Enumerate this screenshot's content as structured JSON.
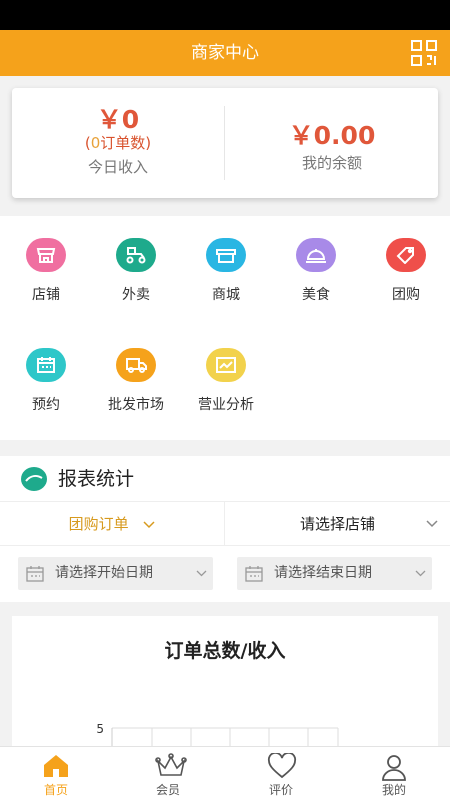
{
  "header": {
    "title": "商家中心",
    "qr_icon": "qr-code-icon"
  },
  "summary": {
    "income_value": "￥0",
    "orders_open": "(",
    "orders_count": "0",
    "orders_label": "订单数)",
    "income_label": "今日收入",
    "balance_value": "￥0.00",
    "balance_label": "我的余额"
  },
  "grid": [
    {
      "label": "店铺",
      "icon": "store-icon",
      "color": "#f06fa0"
    },
    {
      "label": "外卖",
      "icon": "delivery-scooter-icon",
      "color": "#1eaa8c"
    },
    {
      "label": "商城",
      "icon": "shop-mall-icon",
      "color": "#29b6e3"
    },
    {
      "label": "美食",
      "icon": "food-cloche-icon",
      "color": "#a88ae8"
    },
    {
      "label": "团购",
      "icon": "tag-icon",
      "color": "#ef4f4a"
    },
    {
      "label": "预约",
      "icon": "calendar-icon",
      "color": "#2ec7c9"
    },
    {
      "label": "批发市场",
      "icon": "truck-icon",
      "color": "#f5a21b"
    },
    {
      "label": "营业分析",
      "icon": "analytics-chart-icon",
      "color": "#f2d24c"
    }
  ],
  "report": {
    "title": "报表统计",
    "filter_type": "团购订单",
    "filter_store": "请选择店铺",
    "start_date_placeholder": "请选择开始日期",
    "end_date_placeholder": "请选择结束日期"
  },
  "chart_data": {
    "type": "bar",
    "title": "订单总数/收入",
    "categories": [],
    "values": [],
    "ytick": "5"
  },
  "tabs": [
    {
      "label": "首页",
      "icon": "home-icon",
      "active": true
    },
    {
      "label": "会员",
      "icon": "crown-icon",
      "active": false
    },
    {
      "label": "评价",
      "icon": "heart-icon",
      "active": false
    },
    {
      "label": "我的",
      "icon": "user-icon",
      "active": false
    }
  ],
  "colors": {
    "accent": "#f5a21b",
    "money": "#e0573a"
  }
}
